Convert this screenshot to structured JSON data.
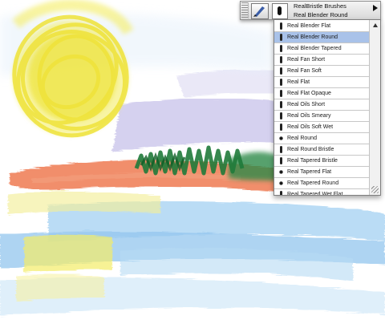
{
  "toolbar": {
    "category_label": "RealBristle Brushes",
    "selected_brush": "Real Blender Round"
  },
  "brush_list": {
    "items": [
      {
        "label": "Real Blender Flat",
        "selected": false,
        "icon": "flat-brush-icon"
      },
      {
        "label": "Real Blender Round",
        "selected": true,
        "icon": "flat-brush-icon"
      },
      {
        "label": "Real Blender Tapered",
        "selected": false,
        "icon": "flat-brush-icon"
      },
      {
        "label": "Real Fan Short",
        "selected": false,
        "icon": "flat-brush-icon"
      },
      {
        "label": "Real Fan Soft",
        "selected": false,
        "icon": "flat-brush-icon"
      },
      {
        "label": "Real Flat",
        "selected": false,
        "icon": "flat-brush-icon"
      },
      {
        "label": "Real Flat Opaque",
        "selected": false,
        "icon": "flat-brush-icon"
      },
      {
        "label": "Real Oils Short",
        "selected": false,
        "icon": "flat-brush-icon"
      },
      {
        "label": "Real Oils Smeary",
        "selected": false,
        "icon": "flat-brush-icon"
      },
      {
        "label": "Real Oils Soft Wet",
        "selected": false,
        "icon": "flat-brush-icon"
      },
      {
        "label": "Real Round",
        "selected": false,
        "icon": "round-brush-icon"
      },
      {
        "label": "Real Round Bristle",
        "selected": false,
        "icon": "flat-brush-icon"
      },
      {
        "label": "Real Tapered Bristle",
        "selected": false,
        "icon": "flat-brush-icon"
      },
      {
        "label": "Real Tapered Flat",
        "selected": false,
        "icon": "round-brush-icon"
      },
      {
        "label": "Real Tapered Round",
        "selected": false,
        "icon": "round-brush-icon"
      },
      {
        "label": "Real Tapered Wet Flat",
        "selected": false,
        "icon": "flat-brush-icon"
      }
    ]
  },
  "colors": {
    "selection_highlight": "#a9c2e9",
    "sun_yellow": "#f1ea3c",
    "horizon_orange": "#ef7c52",
    "grass_green": "#1f7a3a",
    "sky_lavender": "#b9b3e3",
    "water_blue": "#8ec4ec"
  }
}
